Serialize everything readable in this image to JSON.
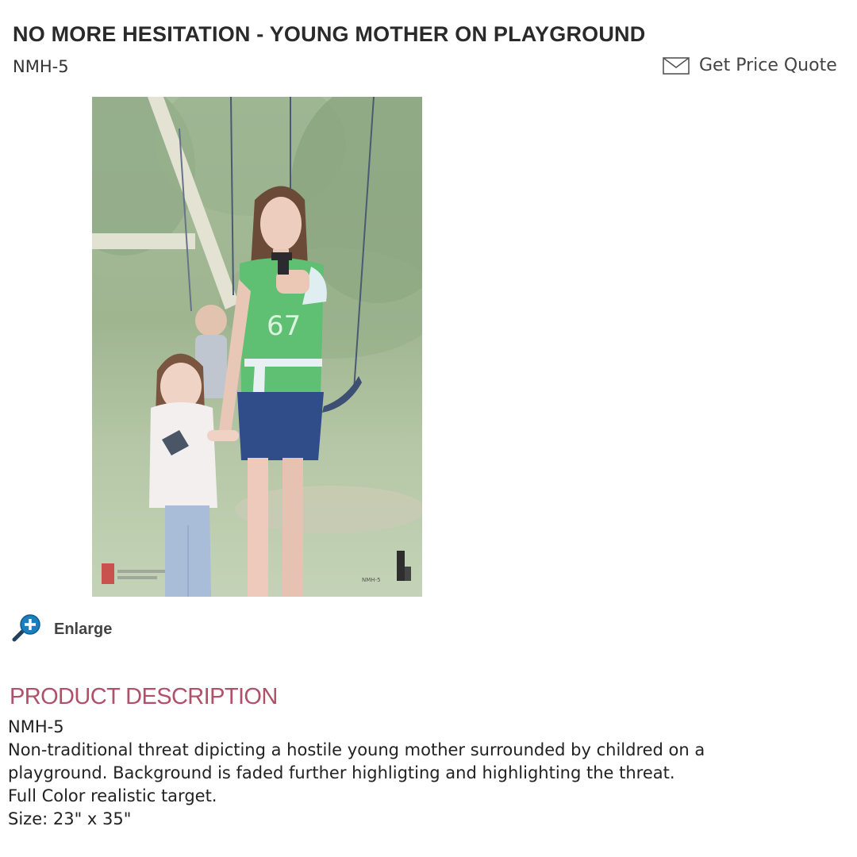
{
  "product": {
    "title": "NO MORE HESITATION - YOUNG MOTHER ON PLAYGROUND",
    "sku": "NMH-5",
    "quote_label": "Get Price Quote",
    "quote_icon": "envelope-icon",
    "image_tag": "NMH-5"
  },
  "enlarge": {
    "label": "Enlarge",
    "icon": "zoom-in-icon"
  },
  "description": {
    "heading": "PRODUCT DESCRIPTION",
    "lines": [
      "NMH-5",
      "Non-traditional threat dipicting a hostile young mother surrounded by childred on a",
      "playground. Background is faded further highligting and highlighting the threat.",
      "Full Color realistic target.",
      "Size: 23\" x 35\""
    ]
  },
  "colors": {
    "heading_accent": "#b0506a",
    "zoom_icon": "#1a7fc0",
    "title_text": "#2a2a2a"
  }
}
